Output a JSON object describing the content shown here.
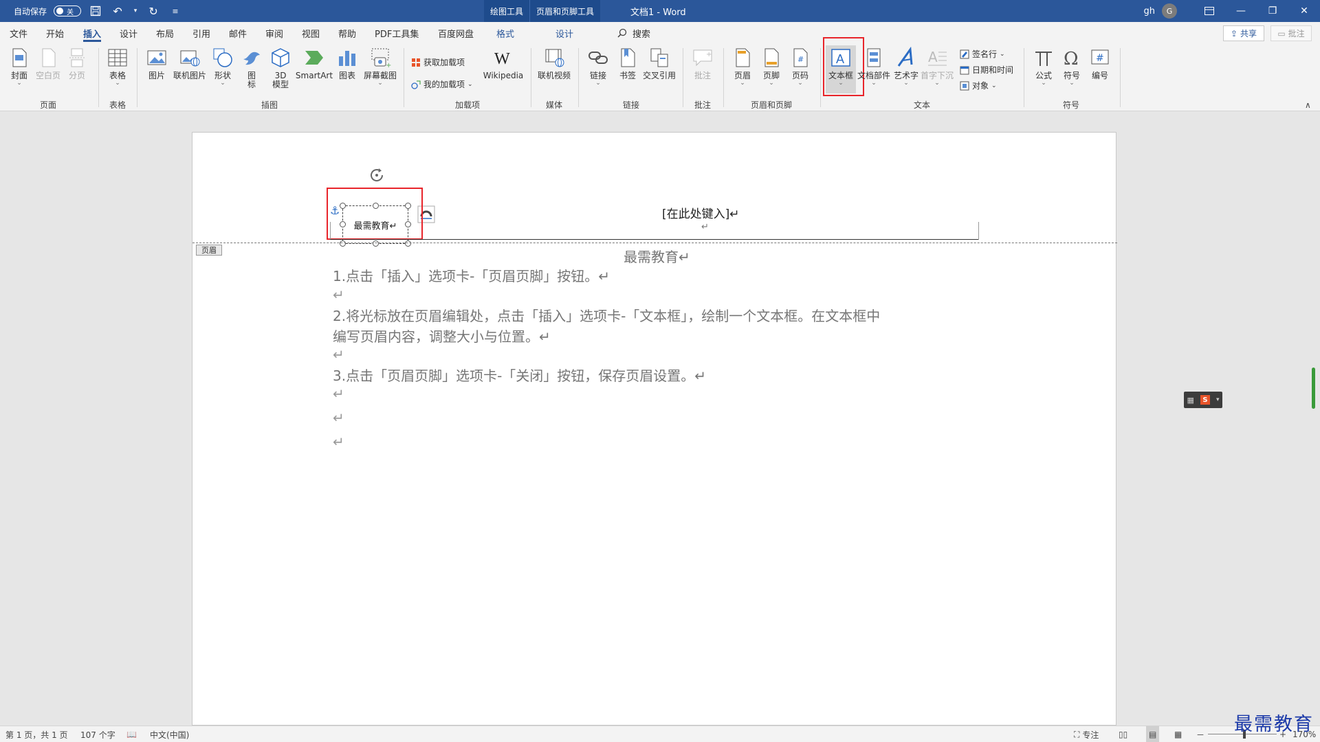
{
  "titlebar": {
    "autosave_label": "自动保存",
    "autosave_state": "关",
    "context_tools": [
      "绘图工具",
      "页眉和页脚工具"
    ],
    "doc_title": "文档1 - Word",
    "user_name": "gh",
    "avatar_initial": "G",
    "accent": "#2b579a"
  },
  "tabs": {
    "items": [
      "文件",
      "开始",
      "插入",
      "设计",
      "布局",
      "引用",
      "邮件",
      "审阅",
      "视图",
      "帮助",
      "PDF工具集",
      "百度网盘",
      "格式",
      "设计"
    ],
    "active": "插入",
    "search_label": "搜索",
    "share_label": "共享",
    "comment_label": "批注"
  },
  "ribbon": {
    "groups": {
      "pages": "页面",
      "tables": "表格",
      "illustrations": "插图",
      "addins": "加载项",
      "media": "媒体",
      "links": "链接",
      "comments": "批注",
      "header_footer": "页眉和页脚",
      "text": "文本",
      "symbols": "符号"
    },
    "buttons": {
      "cover": "封面",
      "blank_page": "空白页",
      "page_break": "分页",
      "table": "表格",
      "picture": "图片",
      "online_picture": "联机图片",
      "shapes": "形状",
      "icons_l1": "图",
      "icons_l2": "标",
      "model3d_l1": "3D",
      "model3d_l2": "模型",
      "smartart": "SmartArt",
      "chart": "图表",
      "screenshot": "屏幕截图",
      "get_addins": "获取加载项",
      "my_addins": "我的加载项",
      "wikipedia": "Wikipedia",
      "online_video": "联机视频",
      "link": "链接",
      "bookmark": "书签",
      "cross_ref": "交叉引用",
      "comment": "批注",
      "header": "页眉",
      "footer": "页脚",
      "page_number": "页码",
      "textbox": "文本框",
      "quick_parts": "文档部件",
      "wordart": "艺术字",
      "drop_cap": "首字下沉",
      "signature_line": "签名行",
      "date_time": "日期和时间",
      "object": "对象",
      "equation": "公式",
      "symbol": "符号",
      "number": "编号"
    }
  },
  "document": {
    "header_tag": "页眉",
    "header_placeholder": "[在此处键入]↵",
    "header_mark": "↵",
    "textbox_text": "最需教育↵",
    "title": "最需教育↵",
    "lines": [
      "1.点击「插入」选项卡-「页眉页脚」按钮。↵",
      "↵",
      "2.将光标放在页眉编辑处，点击「插入」选项卡-「文本框」，绘制一个文本框。在文本框中",
      "编写页眉内容，调整大小与位置。↵",
      "↵",
      "3.点击「页眉页脚」选项卡-「关闭」按钮，保存页眉设置。↵",
      "↵",
      "↵",
      "↵"
    ]
  },
  "statusbar": {
    "page_info": "第 1 页，共 1 页",
    "word_count": "107 个字",
    "language": "中文(中国)",
    "focus": "专注",
    "zoom_minus": "－",
    "zoom_plus": "+",
    "zoom_level": "170%"
  },
  "watermark": "最需教育",
  "colors": {
    "highlight": "#e8242a",
    "accent": "#2b579a"
  }
}
